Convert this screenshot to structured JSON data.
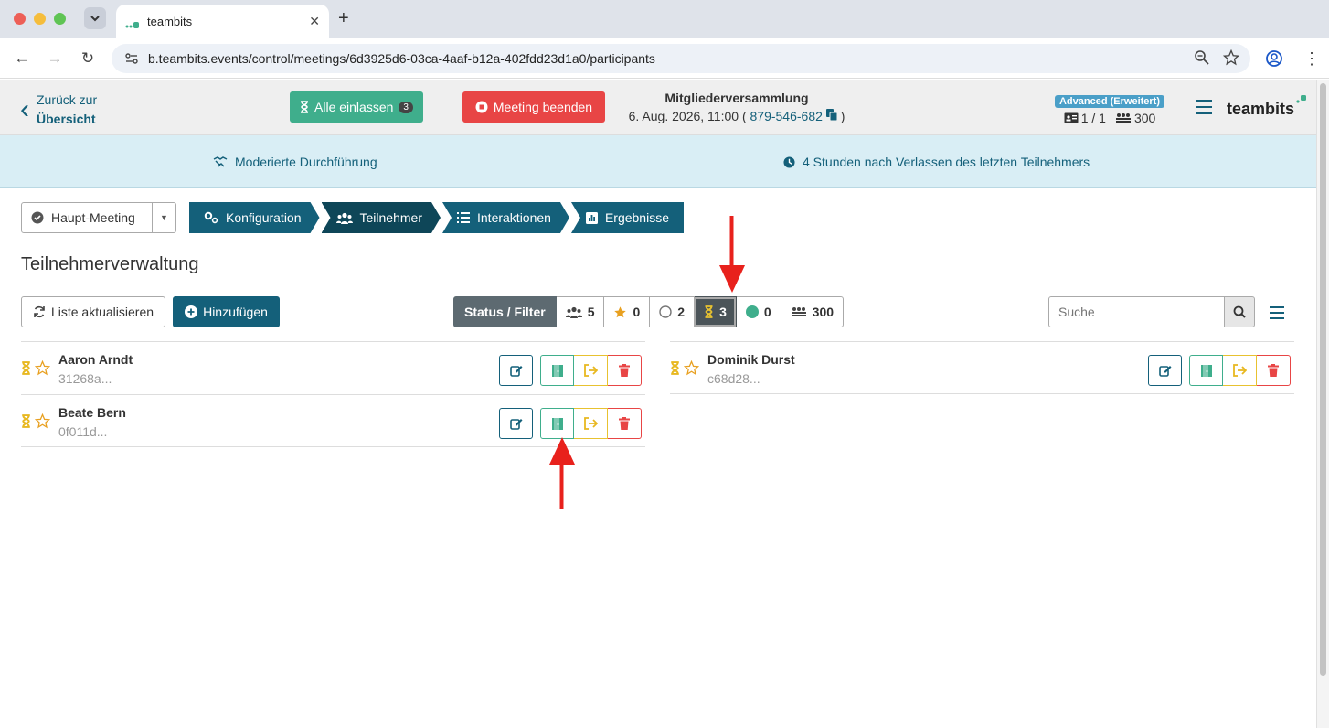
{
  "browser": {
    "tab_title": "teambits",
    "url": "b.teambits.events/control/meetings/6d3925d6-03ca-4aaf-b12a-402fdd23d1a0/participants"
  },
  "header": {
    "back_line1": "Zurück zur",
    "back_line2": "Übersicht",
    "admit_all_label": "Alle einlassen",
    "admit_all_count": "3",
    "end_meeting_label": "Meeting beenden",
    "meeting_title": "Mitgliederversammlung",
    "meeting_date": "6. Aug. 2026, 11:00",
    "meeting_code": "879-546-682",
    "plan_badge": "Advanced (Erweitert)",
    "plan_rooms": "1 / 1",
    "plan_capacity": "300",
    "logo": "teambits"
  },
  "info_bar": {
    "mode": "Moderierte Durchführung",
    "duration": "4 Stunden nach Verlassen des letzten Teilnehmers"
  },
  "meeting_select": {
    "value": "Haupt-Meeting"
  },
  "steps": [
    {
      "label": "Konfiguration"
    },
    {
      "label": "Teilnehmer"
    },
    {
      "label": "Interaktionen"
    },
    {
      "label": "Ergebnisse"
    }
  ],
  "page_title": "Teilnehmerverwaltung",
  "actions": {
    "refresh_label": "Liste aktualisieren",
    "add_label": "Hinzufügen"
  },
  "filters": {
    "label": "Status / Filter",
    "all": "5",
    "starred": "0",
    "offline": "2",
    "waiting": "3",
    "online": "0",
    "capacity": "300"
  },
  "search": {
    "placeholder": "Suche"
  },
  "participants_left": [
    {
      "name": "Aaron Arndt",
      "id": "31268a..."
    },
    {
      "name": "Beate Bern",
      "id": "0f011d..."
    }
  ],
  "participants_right": [
    {
      "name": "Dominik Durst",
      "id": "c68d28..."
    }
  ],
  "colors": {
    "primary": "#14607a",
    "success": "#3fae8c",
    "danger": "#e84545",
    "warning": "#e8c230",
    "info_bg": "#d9eef5",
    "annotation_arrow": "#e8211c"
  }
}
